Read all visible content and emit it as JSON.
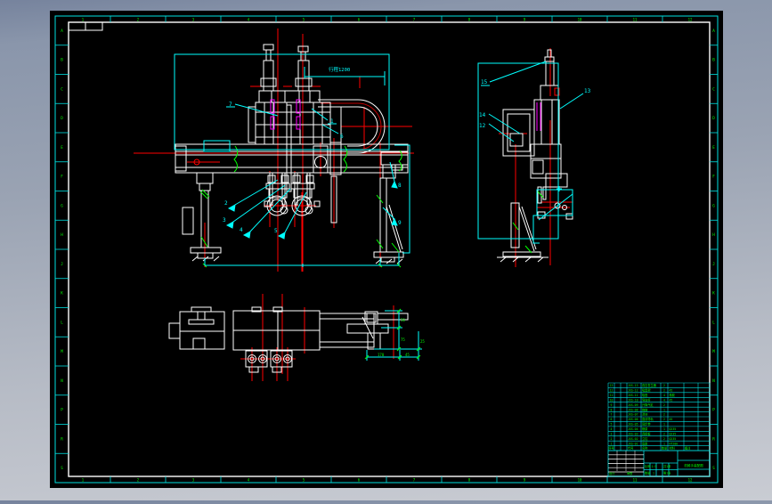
{
  "colors": {
    "canvas": "#000000",
    "frame_cyan": "#00e0e0",
    "dim_cyan": "#00ffff",
    "geometry_white": "#ffffff",
    "centerline_red": "#ff0000",
    "chain_red": "#c00000",
    "note_green": "#00ff00",
    "seal_magenta": "#ff00ff"
  },
  "frame": {
    "top_numbers": [
      "1",
      "2",
      "3",
      "4",
      "5",
      "6",
      "7",
      "8",
      "9",
      "10",
      "11",
      "12"
    ],
    "bottom_numbers": [
      "1",
      "2",
      "3",
      "4",
      "5",
      "6",
      "7",
      "8",
      "9",
      "10",
      "11",
      "12"
    ],
    "left_letters": [
      "A",
      "B",
      "C",
      "D",
      "E",
      "F",
      "G",
      "H",
      "J",
      "K",
      "L",
      "M",
      "N",
      "P",
      "R",
      "S"
    ],
    "right_letters": [
      "A",
      "B",
      "C",
      "D",
      "E",
      "F",
      "G",
      "H",
      "J",
      "K",
      "L",
      "M",
      "N",
      "P",
      "R",
      "S"
    ]
  },
  "annotations": {
    "stroke_label": "行程1200"
  },
  "labels": {
    "front": [
      "7",
      "1",
      "6",
      "2",
      "3",
      "4",
      "5",
      "8",
      "9"
    ],
    "side": [
      "15",
      "14",
      "12",
      "13"
    ]
  },
  "dims": {
    "v1": "50",
    "v2": "75",
    "v3": "25",
    "h1": "170",
    "h2": "45"
  },
  "bom": {
    "header": [
      "序号",
      "代号",
      "名称",
      "数量",
      "材料",
      "备注"
    ],
    "rows": [
      [
        "13",
        "JXS-13",
        "真空发生器",
        "2",
        "",
        ""
      ],
      [
        "12",
        "JXS-12",
        "吸盘架",
        "2",
        "45",
        ""
      ],
      [
        "11",
        "JXS-11",
        "吸盘",
        "4",
        "橡胶",
        ""
      ],
      [
        "10",
        "JXS-10",
        "导向杆",
        "4",
        "45",
        ""
      ],
      [
        "9",
        "JXS-09",
        "升降气缸",
        "2",
        "",
        ""
      ],
      [
        "8",
        "JXS-08",
        "拖链",
        "1",
        "",
        ""
      ],
      [
        "7",
        "JXS-07",
        "滑块",
        "2",
        "",
        ""
      ],
      [
        "6",
        "JXS-06",
        "直线导轨",
        "2",
        "45",
        ""
      ],
      [
        "5",
        "JXS-05",
        "同步带",
        "1",
        "",
        ""
      ],
      [
        "4",
        "JXS-04",
        "横梁",
        "1",
        "Q235",
        ""
      ],
      [
        "3",
        "JXS-03",
        "连接板",
        "2",
        "Q235",
        ""
      ],
      [
        "2",
        "JXS-02",
        "立柱",
        "2",
        "Q235",
        ""
      ],
      [
        "1",
        "JXS-01",
        "底座",
        "1",
        "HT200",
        ""
      ]
    ]
  },
  "title_block": {
    "name": "机械手装配图",
    "scale_label": "比例",
    "scale": "1:5",
    "qty_label": "数量",
    "qty": "1",
    "sheet": "共1张",
    "sheet2": "第1张",
    "field_design": "设计",
    "field_check": "审核"
  }
}
